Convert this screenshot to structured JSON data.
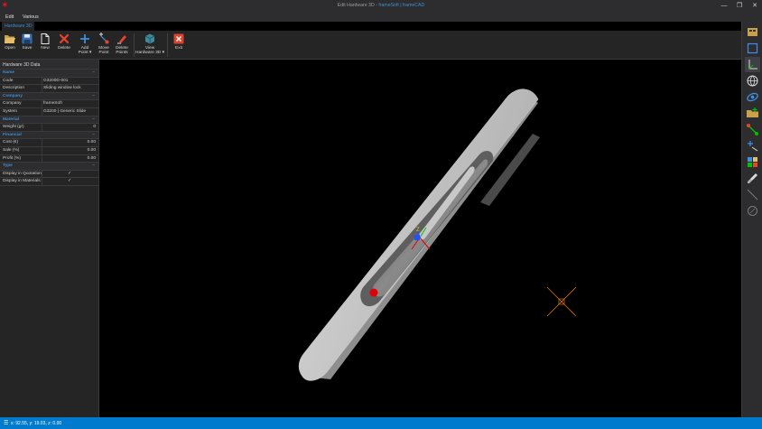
{
  "window": {
    "title_prefix": "Edit Hardware 3D - ",
    "title_app": "frameSoft | frameCAD",
    "logo_glyph": "✶",
    "minimize_glyph": "—",
    "maximize_glyph": "❐",
    "close_glyph": "✕"
  },
  "menu": {
    "items": [
      "Edit",
      "Various"
    ]
  },
  "ribbon": {
    "tab": "Hardware 3D",
    "buttons": [
      {
        "icon": "open-folder-icon",
        "label": "Open"
      },
      {
        "icon": "save-disk-icon",
        "label": "Save"
      },
      {
        "icon": "new-document-icon",
        "label": "New"
      },
      {
        "icon": "delete-x-icon",
        "label": "Delete"
      },
      {
        "icon": "add-point-icon",
        "label": "Add",
        "label2": "Point ▾"
      },
      {
        "icon": "move-point-icon",
        "label": "Move",
        "label2": "Point"
      },
      {
        "icon": "delete-points-icon",
        "label": "Delete",
        "label2": "Points"
      },
      {
        "icon": "view-cube-icon",
        "label": "View",
        "label2": "Hardware 3D ▾"
      },
      {
        "icon": "exit-icon",
        "label": "Exit"
      }
    ]
  },
  "panel": {
    "header": "Hardware 3D Data",
    "collapse_glyph": "−",
    "check_glyph": "✓",
    "categories": {
      "name": "Name",
      "company": "Company",
      "material": "Material",
      "financial": "Financial",
      "type": "Type"
    },
    "rows": {
      "code": {
        "label": "Code",
        "value": "G3200D-001"
      },
      "description": {
        "label": "Description",
        "value": "Sliding window lock"
      },
      "company": {
        "label": "Company",
        "value": "frameSoft"
      },
      "system": {
        "label": "System",
        "value": "G3200 | Generic Slide"
      },
      "weight": {
        "label": "Weight (gr)",
        "value": "0"
      },
      "cost": {
        "label": "Cost (€)",
        "value": "0.00"
      },
      "sale": {
        "label": "Sale (%)",
        "value": "0.00"
      },
      "profit": {
        "label": "Profit (%)",
        "value": "0.00"
      },
      "display_quotation": {
        "label": "Display in Quotation",
        "checked": true
      },
      "display_materials": {
        "label": "Display in Materials",
        "checked": true
      }
    }
  },
  "viewport": {
    "axis_label_z": "Z",
    "point_color": "#e00000",
    "cursor_color": "#d4700a"
  },
  "right_toolbar": {
    "tools": [
      "window-frame-icon",
      "rectangle-icon",
      "axis-origin-icon",
      "globe-icon",
      "orbit-icon",
      "folder-add-icon",
      "connect-node-icon",
      "add-edge-icon",
      "color-grid-icon",
      "brush-icon",
      "line-icon",
      "circle-icon"
    ]
  },
  "status": {
    "icon": "☰",
    "coords": "x: 92.55, y: 19.03, z: 0.00"
  },
  "colors": {
    "accent": "#007acc",
    "label_blue": "#3e8ed0",
    "panel_bg": "#252526"
  }
}
